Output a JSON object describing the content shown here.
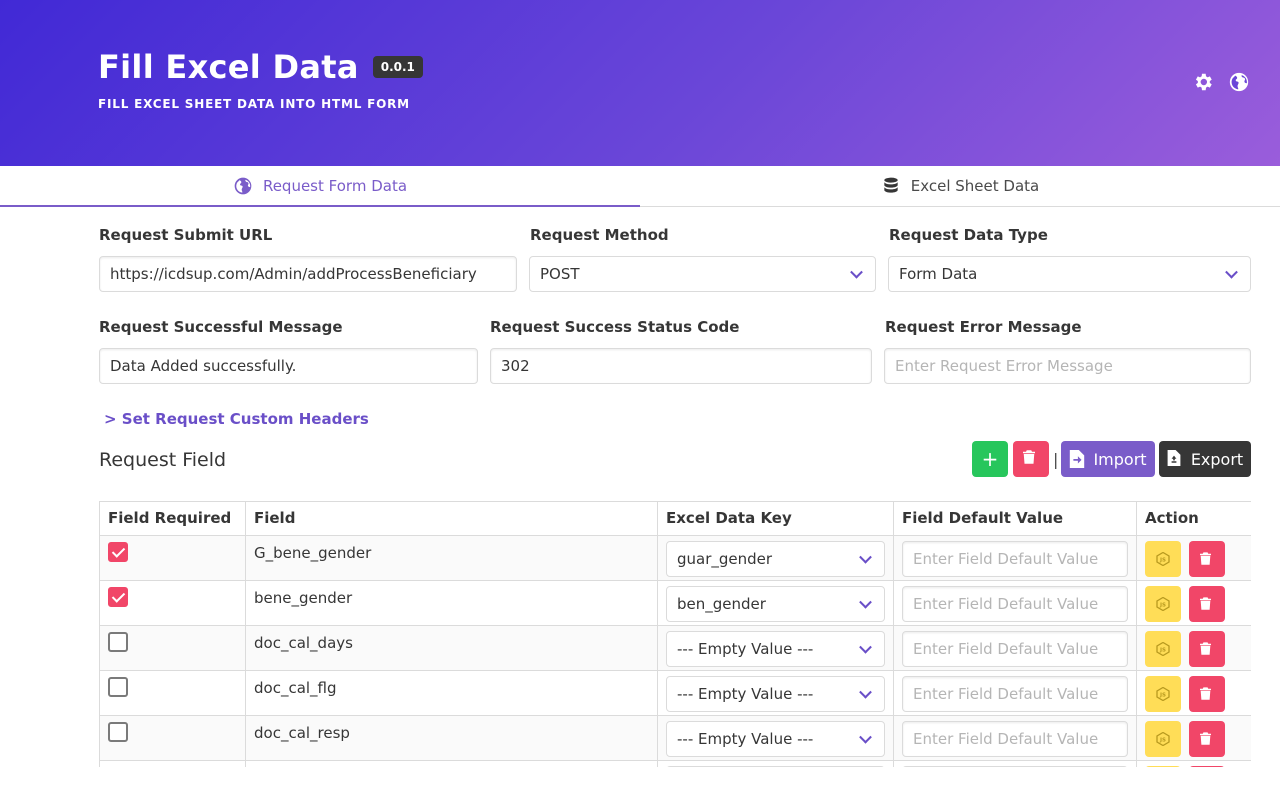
{
  "header": {
    "title": "Fill Excel Data",
    "version": "0.0.1",
    "subtitle": "FILL EXCEL SHEET DATA INTO HTML FORM",
    "icons": [
      "gear-icon",
      "globe-icon"
    ],
    "gradient_colors": [
      "#4129d6",
      "#9a5ddb"
    ]
  },
  "tabs": [
    {
      "label": "Request Form Data",
      "icon": "globe-icon",
      "active": true
    },
    {
      "label": "Excel Sheet Data",
      "icon": "database-icon",
      "active": false
    }
  ],
  "form": {
    "submit_url": {
      "label": "Request Submit URL",
      "value": "https://icdsup.com/Admin/addProcessBeneficiary"
    },
    "method": {
      "label": "Request Method",
      "value": "POST"
    },
    "data_type": {
      "label": "Request Data Type",
      "value": "Form Data"
    },
    "success_message": {
      "label": "Request Successful Message",
      "value": "Data Added successfully."
    },
    "success_code": {
      "label": "Request Success Status Code",
      "value": "302"
    },
    "error_message": {
      "label": "Request Error Message",
      "placeholder": "Enter Request Error Message"
    },
    "custom_headers_link": "> Set Request Custom Headers"
  },
  "request_field": {
    "title": "Request Field",
    "add_label": "+",
    "separator": "|",
    "import_label": "Import",
    "export_label": "Export",
    "colors": {
      "add": "#27c65c",
      "delete": "#f14668",
      "import": "#7a5cc9",
      "export": "#363636"
    }
  },
  "table": {
    "headers": [
      "Field Required",
      "Field",
      "Excel Data Key",
      "Field Default Value",
      "Action"
    ],
    "default_placeholder": "Enter Field Default Value",
    "rows": [
      {
        "required": true,
        "field": "G_bene_gender",
        "key": "guar_gender"
      },
      {
        "required": true,
        "field": "bene_gender",
        "key": "ben_gender"
      },
      {
        "required": false,
        "field": "doc_cal_days",
        "key": "--- Empty Value ---"
      },
      {
        "required": false,
        "field": "doc_cal_flg",
        "key": "--- Empty Value ---"
      },
      {
        "required": false,
        "field": "doc_cal_resp",
        "key": "--- Empty Value ---"
      },
      {
        "required": false,
        "field": "",
        "key": ""
      }
    ]
  }
}
